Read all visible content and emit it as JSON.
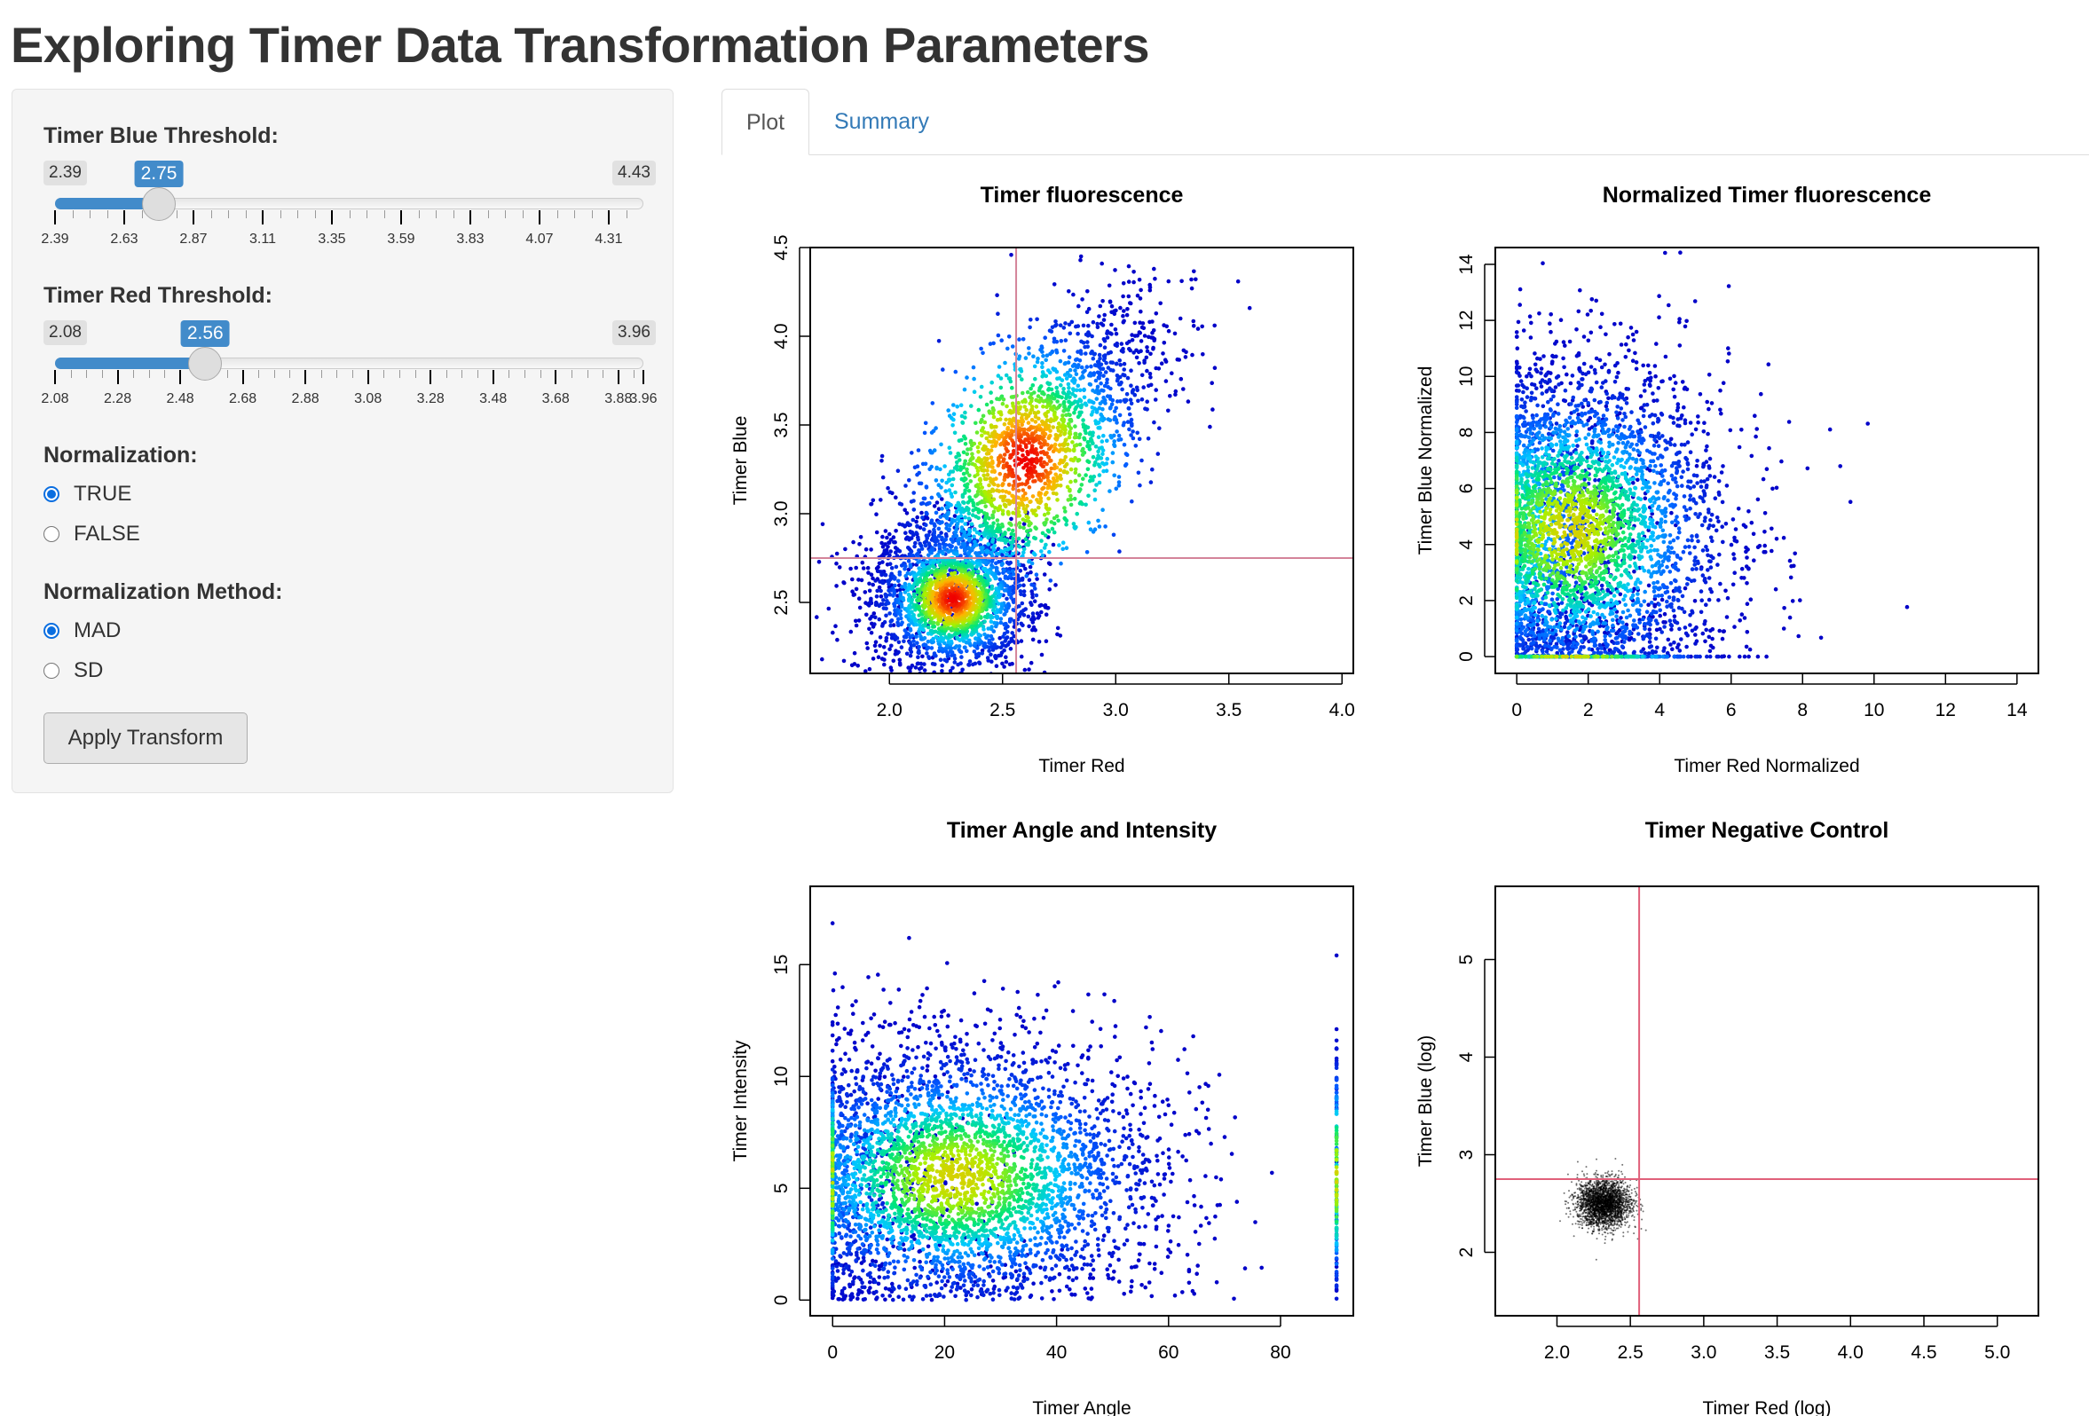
{
  "page": {
    "title": "Exploring Timer Data Transformation Parameters"
  },
  "sidebar": {
    "blue_slider": {
      "label": "Timer Blue Threshold:",
      "min": 2.39,
      "max": 4.43,
      "value": 2.75,
      "min_label": "2.39",
      "max_label": "4.43",
      "value_label": "2.75",
      "tick_labels": [
        "2.39",
        "2.63",
        "2.87",
        "3.11",
        "3.35",
        "3.59",
        "3.83",
        "4.07",
        "4.31"
      ]
    },
    "red_slider": {
      "label": "Timer Red Threshold:",
      "min": 2.08,
      "max": 3.96,
      "value": 2.56,
      "min_label": "2.08",
      "max_label": "3.96",
      "value_label": "2.56",
      "tick_labels": [
        "2.08",
        "2.28",
        "2.48",
        "2.68",
        "2.88",
        "3.08",
        "3.28",
        "3.48",
        "3.68",
        "3.88",
        "3.96"
      ]
    },
    "normalization": {
      "label": "Normalization:",
      "options": [
        {
          "label": "TRUE",
          "checked": true
        },
        {
          "label": "FALSE",
          "checked": false
        }
      ]
    },
    "normalization_method": {
      "label": "Normalization Method:",
      "options": [
        {
          "label": "MAD",
          "checked": true
        },
        {
          "label": "SD",
          "checked": false
        }
      ]
    },
    "apply_button": "Apply Transform",
    "colors": {
      "accent": "#428bca",
      "radio": "#0a6ee0"
    }
  },
  "tabs": [
    {
      "label": "Plot",
      "active": true
    },
    {
      "label": "Summary",
      "active": false
    }
  ],
  "chart_data": [
    {
      "type": "scatter",
      "title": "Timer fluorescence",
      "xlabel": "Timer Red",
      "ylabel": "Timer Blue",
      "xlim": [
        1.65,
        4.05
      ],
      "ylim": [
        2.1,
        4.5
      ],
      "xticks": [
        "2.0",
        "2.5",
        "3.0",
        "3.5",
        "4.0"
      ],
      "yticks": [
        "2.5",
        "3.0",
        "3.5",
        "4.0",
        "4.5"
      ],
      "xtick_values": [
        2.0,
        2.5,
        3.0,
        3.5,
        4.0
      ],
      "ytick_values": [
        2.5,
        3.0,
        3.5,
        4.0,
        4.5
      ],
      "vline": 2.56,
      "hline": 2.75,
      "threshold_color": "#d4849a",
      "coloring": "density (blue→cyan→green→yellow→red)",
      "clusters": [
        {
          "x": 2.28,
          "y": 2.52,
          "sx": 0.17,
          "sy": 0.2,
          "w": 0.45
        },
        {
          "x": 2.6,
          "y": 3.3,
          "sx": 0.3,
          "sy": 0.45,
          "w": 0.55,
          "corr": 0.7
        }
      ]
    },
    {
      "type": "scatter",
      "title": "Normalized Timer fluorescence",
      "xlabel": "Timer Red Normalized",
      "ylabel": "Timer Blue Normalized",
      "xlim": [
        -0.6,
        14.6
      ],
      "ylim": [
        -0.6,
        14.6
      ],
      "xticks": [
        "0",
        "2",
        "4",
        "6",
        "8",
        "10",
        "12",
        "14"
      ],
      "yticks": [
        "0",
        "2",
        "4",
        "6",
        "8",
        "10",
        "12",
        "14"
      ],
      "xtick_values": [
        0,
        2,
        4,
        6,
        8,
        10,
        12,
        14
      ],
      "ytick_values": [
        0,
        2,
        4,
        6,
        8,
        10,
        12,
        14
      ],
      "coloring": "density (blue→cyan→green→yellow→red)",
      "clusters": [
        {
          "x": 1.5,
          "y": 4.5,
          "sx": 2.2,
          "sy": 3.0,
          "w": 1.0
        }
      ]
    },
    {
      "type": "scatter",
      "title": "Timer Angle and Intensity",
      "xlabel": "Timer Angle",
      "ylabel": "Timer Intensity",
      "xlim": [
        -4,
        93
      ],
      "ylim": [
        -0.7,
        18.5
      ],
      "xticks": [
        "0",
        "20",
        "40",
        "60",
        "80"
      ],
      "yticks": [
        "0",
        "5",
        "10",
        "15"
      ],
      "xtick_values": [
        0,
        20,
        40,
        60,
        80
      ],
      "ytick_values": [
        0,
        5,
        10,
        15
      ],
      "coloring": "density (blue→cyan→green→yellow→red)",
      "clusters": [
        {
          "x": 22,
          "y": 5.5,
          "sx": 18,
          "sy": 3.0,
          "w": 1.0
        }
      ]
    },
    {
      "type": "scatter",
      "title": "Timer Negative Control",
      "xlabel": "Timer Red (log)",
      "ylabel": "Timer Blue (log)",
      "xlim": [
        1.58,
        5.28
      ],
      "ylim": [
        1.35,
        5.75
      ],
      "xticks": [
        "2.0",
        "2.5",
        "3.0",
        "3.5",
        "4.0",
        "4.5",
        "5.0"
      ],
      "yticks": [
        "2",
        "3",
        "4",
        "5"
      ],
      "xtick_values": [
        2.0,
        2.5,
        3.0,
        3.5,
        4.0,
        4.5,
        5.0
      ],
      "ytick_values": [
        2,
        3,
        4,
        5
      ],
      "vline": 2.56,
      "hline": 2.75,
      "threshold_color": "#e0607a",
      "point_color": "#000000",
      "clusters": [
        {
          "x": 2.32,
          "y": 2.5,
          "sx": 0.09,
          "sy": 0.12,
          "w": 1.0
        }
      ]
    }
  ]
}
